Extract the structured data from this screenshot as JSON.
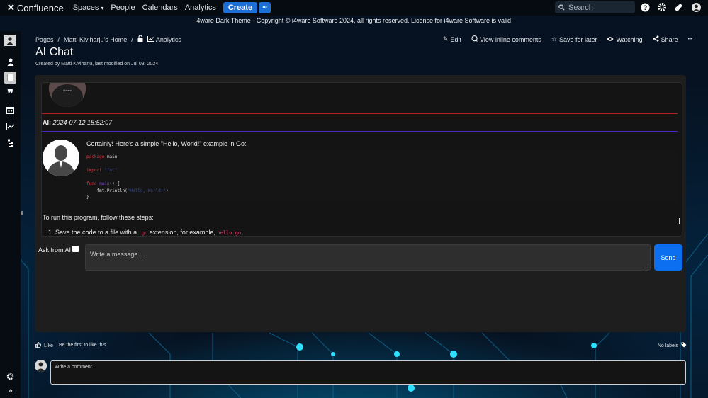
{
  "topnav": {
    "logo_text": "Confluence",
    "spaces": "Spaces",
    "people": "People",
    "calendars": "Calendars",
    "analytics": "Analytics",
    "create": "Create",
    "more": "•••",
    "search_placeholder": "Search"
  },
  "banner": "i4ware Dark Theme - Copyright © i4ware Software 2024, all rights reserved. License for i4ware Software is valid.",
  "breadcrumb": {
    "pages": "Pages",
    "sep": "/",
    "home": "Matti Kiviharju's Home",
    "analytics": "Analytics"
  },
  "actions": {
    "edit": "Edit",
    "inline_comments": "View inline comments",
    "save_later": "Save for later",
    "watching": "Watching",
    "share": "Share",
    "more": "•••"
  },
  "page": {
    "title": "AI Chat",
    "byline": "Created by Matti Kiviharju, last modified on Jul 03, 2024"
  },
  "chat": {
    "ai_label": "AI:",
    "timestamp": "2024-07-12 18:52:07",
    "intro": "Certainly! Here's a simple \"Hello, World!\" example in Go:",
    "code": {
      "line1_kw": "package",
      "line1_rest": " main",
      "line2_kw": "import",
      "line2_str": " \"fmt\"",
      "line3_kw": "func",
      "line3_name": " main",
      "line3_rest": "() {",
      "line4_pre": "    fmt.Println(",
      "line4_str": "\"Hello, World!\"",
      "line4_post": ")",
      "line5": "}"
    },
    "run_text": "To run this program, follow these steps:",
    "step1_num": "1.",
    "step1_a": "Save the code to a file with a",
    "step1_code1": ".go",
    "step1_b": "extension, for example,",
    "step1_code2": "hello.go",
    "step1_c": "."
  },
  "composer": {
    "ask_label": "Ask from AI",
    "placeholder": "Write a message...",
    "send": "Send"
  },
  "footer": {
    "like": "Like",
    "first_like": "Be the first to like this",
    "labels": "No labels",
    "comment_placeholder": "Write a comment..."
  },
  "colors": {
    "accent": "#1d6fd8",
    "send": "#0b6ff0",
    "red_rule": "#b52020",
    "blue_rule": "#4c28c9"
  }
}
